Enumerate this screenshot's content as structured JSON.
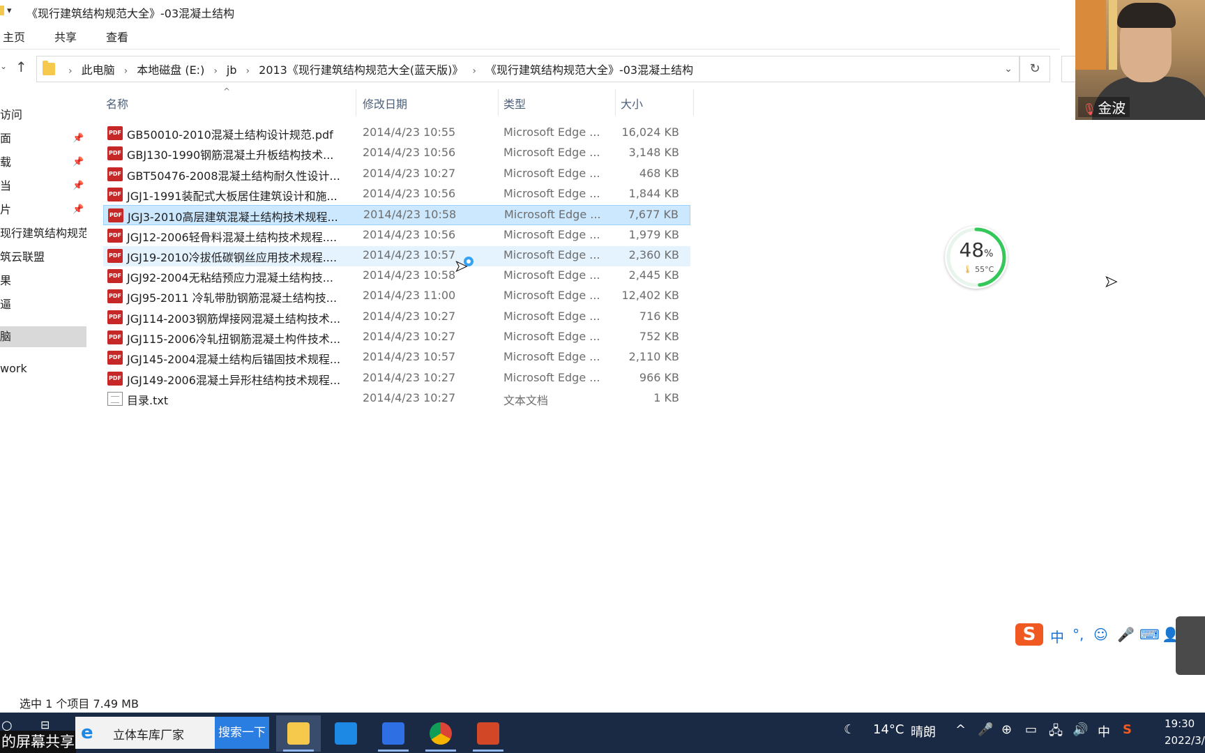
{
  "window": {
    "title": "《现行建筑结构规范大全》-03混凝土结构",
    "quick_access_dropdown": "▾"
  },
  "ribbon": {
    "tabs": [
      "主页",
      "共享",
      "查看"
    ]
  },
  "address": {
    "crumbs": [
      "此电脑",
      "本地磁盘 (E:)",
      "jb",
      "2013《现行建筑结构规范大全(蓝天版)》",
      "《现行建筑结构规范大全》-03混凝土结构"
    ]
  },
  "nav": {
    "items": [
      {
        "label": "访问",
        "pinned": false
      },
      {
        "label": "面",
        "pinned": true
      },
      {
        "label": "载",
        "pinned": true
      },
      {
        "label": "当",
        "pinned": true
      },
      {
        "label": "片",
        "pinned": true
      },
      {
        "label": "现行建筑结构规范",
        "pinned": false
      },
      {
        "label": "筑云联盟",
        "pinned": false
      },
      {
        "label": "果",
        "pinned": false
      },
      {
        "label": "逼",
        "pinned": false
      },
      {
        "label": "脑",
        "pinned": false,
        "selected": true
      },
      {
        "label": "work",
        "pinned": false
      }
    ]
  },
  "columns": {
    "name": "名称",
    "date": "修改日期",
    "type": "类型",
    "size": "大小"
  },
  "files": [
    {
      "name": "GB50010-2010混凝土结构设计规范.pdf",
      "date": "2014/4/23 10:55",
      "type": "Microsoft Edge ...",
      "size": "16,024 KB",
      "icon": "pdf-icon"
    },
    {
      "name": "GBJ130-1990钢筋混凝土升板结构技术...",
      "date": "2014/4/23 10:56",
      "type": "Microsoft Edge ...",
      "size": "3,148 KB",
      "icon": "pdf-icon"
    },
    {
      "name": "GBT50476-2008混凝土结构耐久性设计...",
      "date": "2014/4/23 10:27",
      "type": "Microsoft Edge ...",
      "size": "468 KB",
      "icon": "pdf-icon"
    },
    {
      "name": "JGJ1-1991装配式大板居住建筑设计和施...",
      "date": "2014/4/23 10:56",
      "type": "Microsoft Edge ...",
      "size": "1,844 KB",
      "icon": "pdf-icon"
    },
    {
      "name": "JGJ3-2010高层建筑混凝土结构技术规程...",
      "date": "2014/4/23 10:58",
      "type": "Microsoft Edge ...",
      "size": "7,677 KB",
      "icon": "pdf-icon",
      "selected": true
    },
    {
      "name": "JGJ12-2006轻骨料混凝土结构技术规程....",
      "date": "2014/4/23 10:56",
      "type": "Microsoft Edge ...",
      "size": "1,979 KB",
      "icon": "pdf-icon"
    },
    {
      "name": "JGJ19-2010冷拔低碳钢丝应用技术规程....",
      "date": "2014/4/23 10:57",
      "type": "Microsoft Edge ...",
      "size": "2,360 KB",
      "icon": "pdf-icon",
      "hover": true
    },
    {
      "name": "JGJ92-2004无粘结预应力混凝土结构技...",
      "date": "2014/4/23 10:58",
      "type": "Microsoft Edge ...",
      "size": "2,445 KB",
      "icon": "pdf-icon"
    },
    {
      "name": "JGJ95-2011 冷轧带肋钢筋混凝土结构技...",
      "date": "2014/4/23 11:00",
      "type": "Microsoft Edge ...",
      "size": "12,402 KB",
      "icon": "pdf-icon"
    },
    {
      "name": "JGJ114-2003钢筋焊接网混凝土结构技术...",
      "date": "2014/4/23 10:27",
      "type": "Microsoft Edge ...",
      "size": "716 KB",
      "icon": "pdf-icon"
    },
    {
      "name": "JGJ115-2006冷轧扭钢筋混凝土构件技术...",
      "date": "2014/4/23 10:27",
      "type": "Microsoft Edge ...",
      "size": "752 KB",
      "icon": "pdf-icon"
    },
    {
      "name": "JGJ145-2004混凝土结构后锚固技术规程...",
      "date": "2014/4/23 10:57",
      "type": "Microsoft Edge ...",
      "size": "2,110 KB",
      "icon": "pdf-icon"
    },
    {
      "name": "JGJ149-2006混凝土异形柱结构技术规程...",
      "date": "2014/4/23 10:27",
      "type": "Microsoft Edge ...",
      "size": "966 KB",
      "icon": "pdf-icon"
    },
    {
      "name": "目录.txt",
      "date": "2014/4/23 10:27",
      "type": "文本文档",
      "size": "1 KB",
      "icon": "txt-icon"
    }
  ],
  "status": {
    "text": "选中 1 个项目  7.49 MB"
  },
  "gauge": {
    "percent": "48",
    "percent_unit": "%",
    "temperature": "55°C",
    "fraction": 0.48,
    "color": "#34c759"
  },
  "webcam": {
    "name": "金波"
  },
  "ime": {
    "logo": "S",
    "items": [
      "中",
      "°,",
      "☺",
      "🎤",
      "⌨",
      "👤",
      "👕"
    ]
  },
  "taskbar": {
    "share_label": "的屏幕共享",
    "search_text": "立体车库厂家",
    "search_button": "搜索一下",
    "weather_icon": "moon-icon",
    "temperature": "14°C",
    "weather": "晴朗",
    "ime_indicator": "中",
    "time": "19:30",
    "date": "2022/3/4"
  },
  "colors": {
    "accent": "#2a7de1",
    "selection": "#cce8ff",
    "taskbar": "#1b2a44",
    "pdf": "#c62828"
  }
}
